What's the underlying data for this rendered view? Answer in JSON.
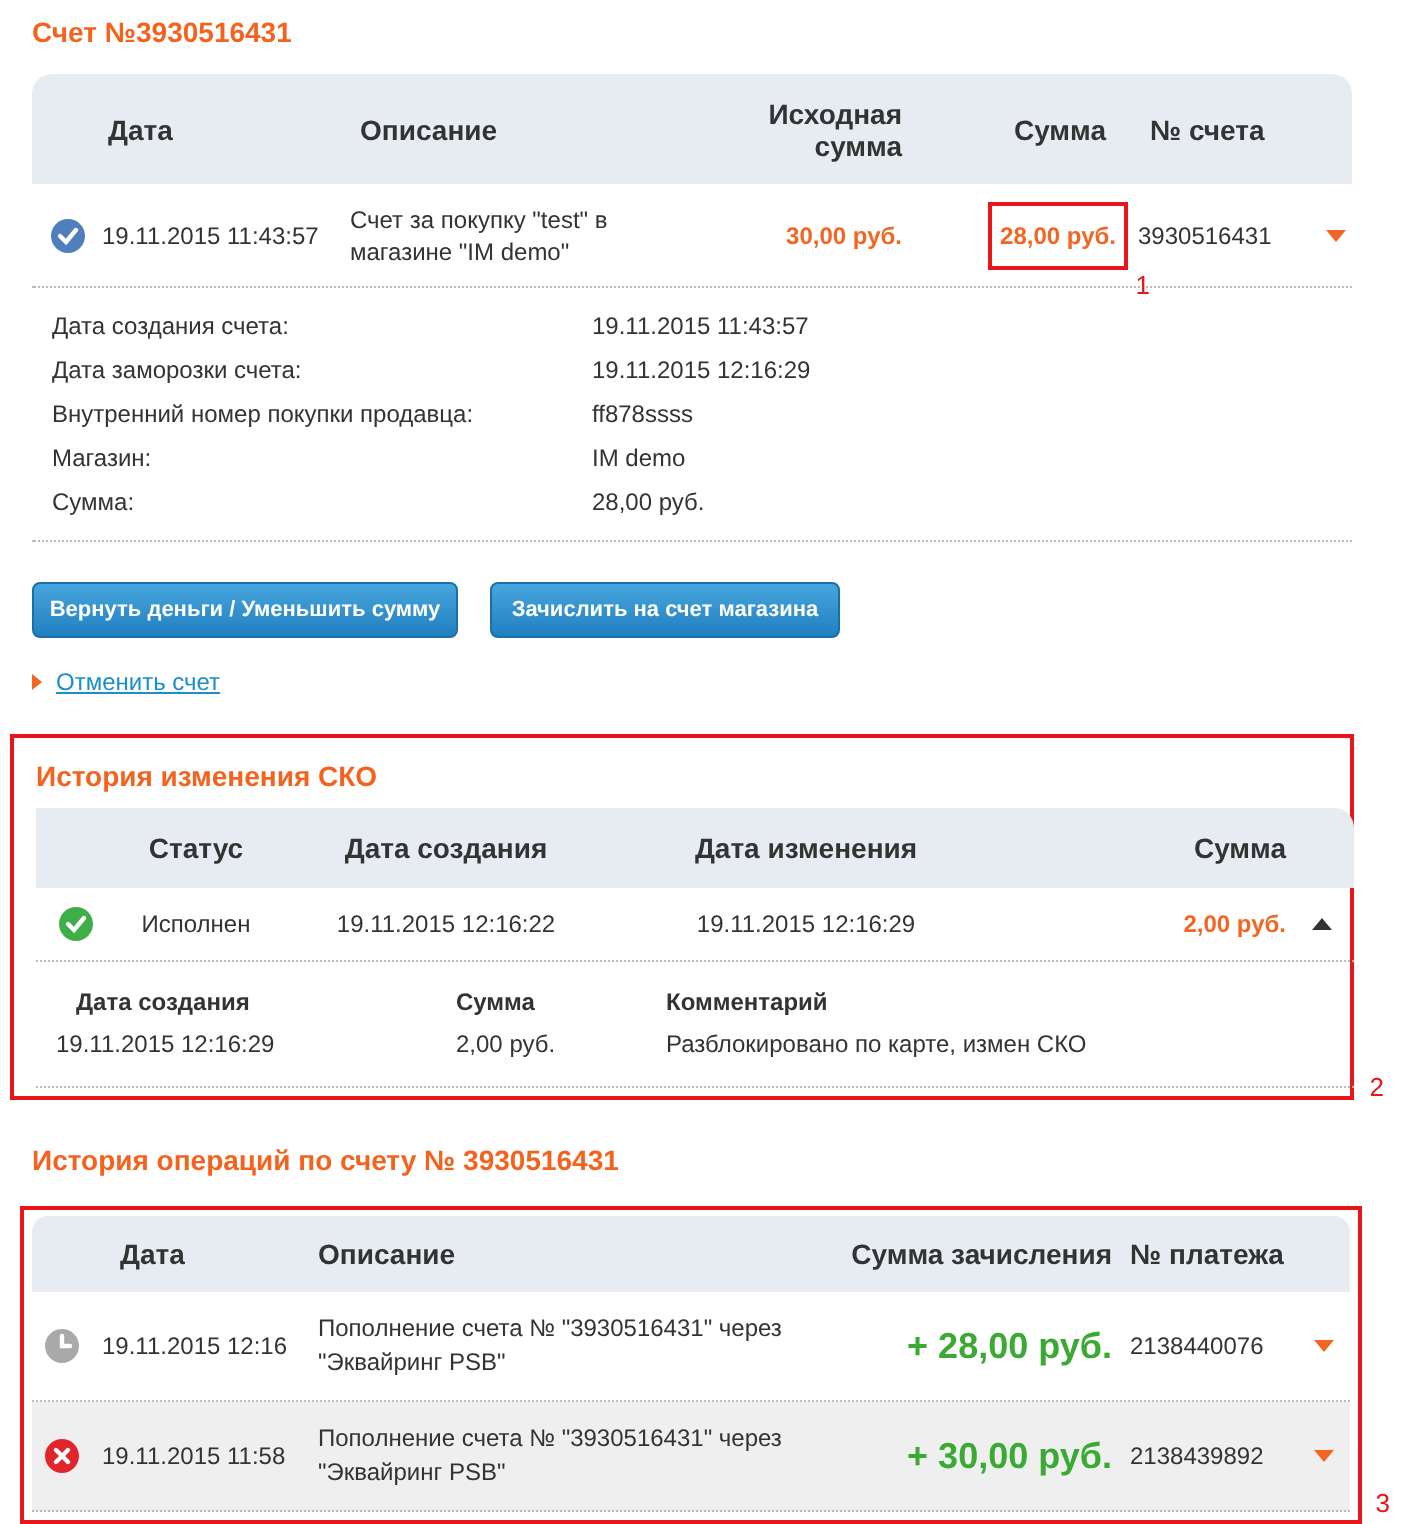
{
  "invoice": {
    "title": "Счет №3930516431",
    "columns": [
      "Дата",
      "Описание",
      "Исходная сумма",
      "Сумма",
      "№ счета"
    ],
    "row": {
      "kind": "confirmed",
      "date": "19.11.2015 11:43:57",
      "description": "Счет за покупку \"test\" в магазине \"IM demo\"",
      "original_amount": "30,00 руб.",
      "amount": "28,00 руб.",
      "amount_annotation": "1",
      "number": "3930516431"
    },
    "details": [
      {
        "label": "Дата создания счета:",
        "value": "19.11.2015 11:43:57"
      },
      {
        "label": "Дата заморозки счета:",
        "value": "19.11.2015 12:16:29"
      },
      {
        "label": "Внутренний номер покупки продавца:",
        "value": "ff878ssss"
      },
      {
        "label": "Магазин:",
        "value": "IM demo"
      },
      {
        "label": "Сумма:",
        "value": "28,00 руб."
      }
    ],
    "buttons": [
      "Вернуть деньги / Уменьшить сумму",
      "Зачислить на счет магазина"
    ],
    "cancel_link": "Отменить счет"
  },
  "sko_history": {
    "title": "История изменения СКО",
    "annotation": "2",
    "columns": [
      "Статус",
      "Дата создания",
      "Дата изменения",
      "Сумма"
    ],
    "rows": [
      {
        "kind": "done",
        "status_text": "Исполнен",
        "created": "19.11.2015 12:16:22",
        "changed": "19.11.2015 12:16:29",
        "amount": "2,00 руб.",
        "expanded": true,
        "detail_columns": [
          "Дата создания",
          "Сумма",
          "Комментарий"
        ],
        "detail_rows": [
          [
            "19.11.2015 12:16:29",
            "2,00 руб.",
            "Разблокировано по карте, измен СКО"
          ]
        ]
      }
    ]
  },
  "operations": {
    "title": "История операций по счету № 3930516431",
    "annotation": "3",
    "columns": [
      "Дата",
      "Описание",
      "Сумма зачисления",
      "№ платежа"
    ],
    "rows": [
      {
        "kind": "pending",
        "date": "19.11.2015 12:16",
        "description": "Пополнение счета № \"3930516431\" через \"Эквайринг PSB\"",
        "amount": "+ 28,00 руб.",
        "number": "2138440076",
        "expanded": false,
        "selected": false
      },
      {
        "kind": "failed",
        "date": "19.11.2015 11:58",
        "description": "Пополнение счета № \"3930516431\" через \"Эквайринг PSB\"",
        "amount": "+ 30,00 руб.",
        "number": "2138439892",
        "expanded": false,
        "selected": true
      }
    ]
  }
}
